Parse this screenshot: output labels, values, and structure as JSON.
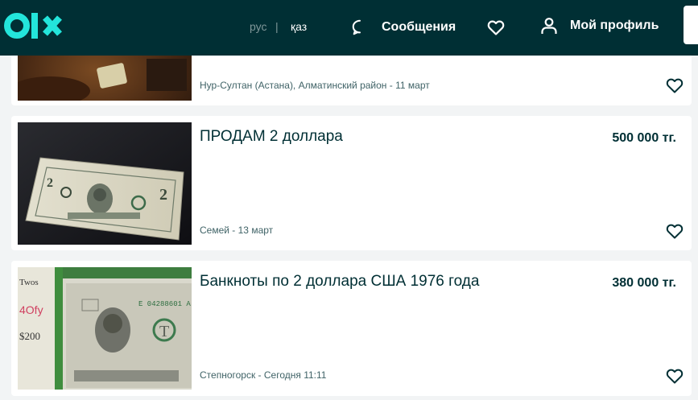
{
  "header": {
    "lang_ru": "рус",
    "lang_sep": "|",
    "lang_kz": "қаз",
    "messages_label": "Сообщения",
    "profile_label": "Мой профиль"
  },
  "listings": [
    {
      "title": "",
      "price": "",
      "location_date": "Нур-Султан (Астана), Алматинский район - 11 март"
    },
    {
      "title": "ПРОДАМ 2 доллара",
      "price": "500 000 тг.",
      "location_date": "Семей - 13 март"
    },
    {
      "title": "Банкноты по 2 доллара США 1976 года",
      "price": "380 000 тг.",
      "location_date": "Степногорск - Сегодня 11:11"
    }
  ],
  "colors": {
    "header_bg": "#002f34",
    "logo_accent": "#23e5db",
    "page_bg": "#f2f4f5"
  },
  "icons": {
    "messages": "chat-bubble-icon",
    "favorites": "heart-icon",
    "profile": "user-icon"
  }
}
